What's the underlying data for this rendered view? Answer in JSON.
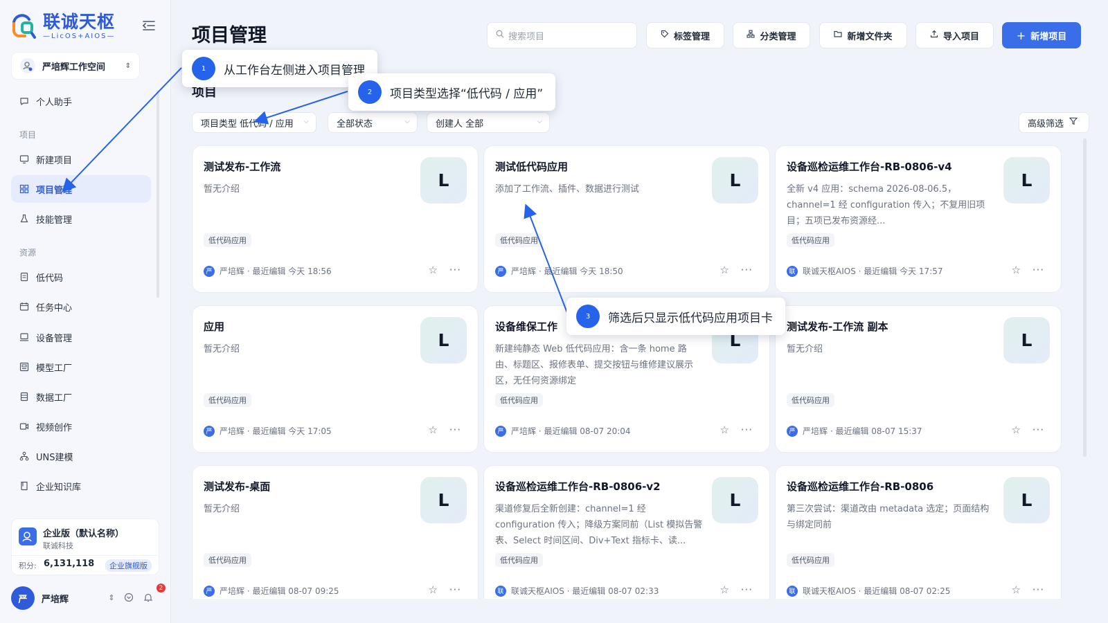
{
  "brand": {
    "name_cn": "联诚天枢",
    "name_en": "—LicOS+AIOS—",
    "accent": "#3a6ee8"
  },
  "workspace": {
    "label": "严培辉工作空间"
  },
  "sidebar": {
    "items": [
      {
        "label": "个人助手",
        "icon": "chat-icon"
      },
      {
        "label": "新建项目",
        "icon": "monitor-icon"
      },
      {
        "label": "项目管理",
        "icon": "grid-icon",
        "active": true
      },
      {
        "label": "技能管理",
        "icon": "flask-icon"
      },
      {
        "label": "低代码",
        "icon": "document-icon"
      },
      {
        "label": "任务中心",
        "icon": "calendar-icon"
      },
      {
        "label": "设备管理",
        "icon": "laptop-icon"
      },
      {
        "label": "模型工厂",
        "icon": "model-icon"
      },
      {
        "label": "数据工厂",
        "icon": "database-icon"
      },
      {
        "label": "视频创作",
        "icon": "video-icon"
      },
      {
        "label": "UNS建模",
        "icon": "hierarchy-icon"
      },
      {
        "label": "企业知识库",
        "icon": "book-icon"
      }
    ],
    "section_project": "项目",
    "section_resource": "资源"
  },
  "enterprise": {
    "name": "企业版（默认名称）",
    "company": "联诚科技",
    "score_label": "积分:",
    "score": "6,131,118",
    "badge": "企业旗舰版"
  },
  "user": {
    "avatar_char": "严",
    "name": "严培辉",
    "notifications": "2"
  },
  "header": {
    "title": "项目管理",
    "search_placeholder": "搜索项目",
    "buttons": [
      "标签管理",
      "分类管理",
      "新增文件夹",
      "导入项目"
    ],
    "primary": "新增项目"
  },
  "section": {
    "title": "项目"
  },
  "filters": {
    "type": "项目类型 低代码 / 应用",
    "status": "全部状态",
    "creator": "创建人 全部",
    "advanced": "高级筛选"
  },
  "cards": [
    {
      "title": "测试发布-工作流",
      "desc": "暂无介绍",
      "tag": "低代码应用",
      "avatar": "严",
      "meta": "严培辉 · 最近编辑 今天 18:56",
      "icon": "L"
    },
    {
      "title": "测试低代码应用",
      "desc": "添加了工作流、插件、数据进行测试",
      "tag": "低代码应用",
      "avatar": "严",
      "meta": "严培辉 · 最近编辑 今天 18:50",
      "icon": "L"
    },
    {
      "title": "设备巡检运维工作台-RB-0806-v4",
      "desc": "全新 v4 应用：schema 2026-08-06.5，channel=1 经 configuration 传入；不复用旧项目；五项已发布资源经...",
      "tag": "低代码应用",
      "avatar": "联",
      "meta": "联诚天枢AIOS · 最近编辑 今天 17:57",
      "icon": "L"
    },
    {
      "title": "应用",
      "desc": "暂无介绍",
      "tag": "低代码应用",
      "avatar": "严",
      "meta": "严培辉 · 最近编辑 今天 17:05",
      "icon": "L"
    },
    {
      "title": "设备维保工作",
      "desc": "新建纯静态 Web 低代码应用：含一条 home 路由、标题区、报修表单、提交按钮与维修建议展示区，无任何资源绑定",
      "tag": "低代码应用",
      "avatar": "严",
      "meta": "严培辉 · 最近编辑 08-07 20:04",
      "icon": "L"
    },
    {
      "title": "测试发布-工作流 副本",
      "desc": "暂无介绍",
      "tag": "低代码应用",
      "avatar": "严",
      "meta": "严培辉 · 最近编辑 08-07 15:37",
      "icon": "L"
    },
    {
      "title": "测试发布-桌面",
      "desc": "暂无介绍",
      "tag": "低代码应用",
      "avatar": "严",
      "meta": "严培辉 · 最近编辑 08-07 09:25",
      "icon": "L"
    },
    {
      "title": "设备巡检运维工作台-RB-0806-v2",
      "desc": "渠道修复后全新创建：channel=1 经 configuration 传入；降级方案同前（List 模拟告警表、Select 时间区间、Div+Text 指标卡、读...",
      "tag": "低代码应用",
      "avatar": "联",
      "meta": "联诚天枢AIOS · 最近编辑 08-07 02:33",
      "icon": "L"
    },
    {
      "title": "设备巡检运维工作台-RB-0806",
      "desc": "第三次尝试：渠道改由 metadata 选定；页面结构与绑定同前",
      "tag": "低代码应用",
      "avatar": "联",
      "meta": "联诚天枢AIOS · 最近编辑 08-07 02:25",
      "icon": "L"
    }
  ],
  "annotations": [
    {
      "num": "1",
      "text": "从工作台左侧进入项目管理"
    },
    {
      "num": "2",
      "text": "项目类型选择“低代码 / 应用”"
    },
    {
      "num": "3",
      "text": "筛选后只显示低代码应用项目卡"
    }
  ]
}
